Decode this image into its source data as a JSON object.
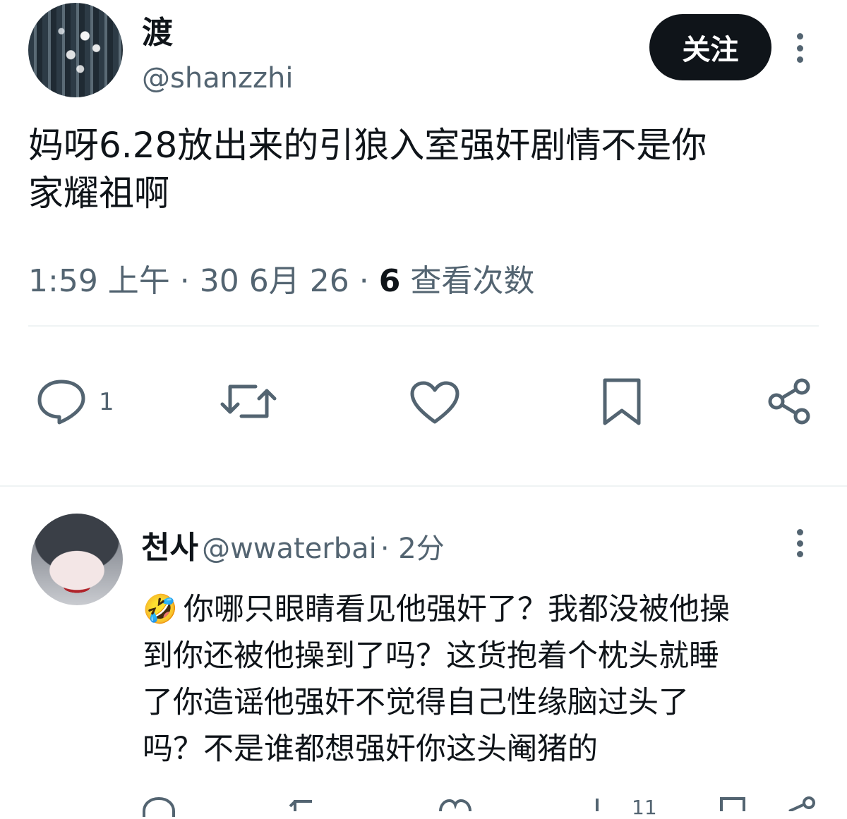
{
  "tweet": {
    "display_name": "渡",
    "handle": "@shanzzhi",
    "follow_label": "关注",
    "text": "妈呀6.28放出来的引狼入室强奸剧情不是你\n家耀祖啊",
    "time": "1:59 上午",
    "date": "30 6月 26",
    "views_count": "6",
    "views_label": "查看次数",
    "reply_count": "1",
    "icons": [
      "reply-icon",
      "retweet-icon",
      "like-icon",
      "bookmark-icon",
      "share-icon",
      "more-icon"
    ]
  },
  "reply": {
    "display_name": "천사",
    "handle": "@wwaterbai",
    "time_ago": "2分",
    "emoji": "🤣",
    "text": "你哪只眼睛看见他强奸了？我都没被他操\n到你还被他操到了吗？这货抱着个枕头就睡\n了你造谣他强奸不觉得自己性缘脑过头了\n吗？不是谁都想强奸你这头阉猪的",
    "views_count": "11"
  },
  "colors": {
    "text": "#0f1419",
    "secondary": "#536471",
    "divider": "#eff3f4",
    "button_bg": "#0f1419"
  }
}
